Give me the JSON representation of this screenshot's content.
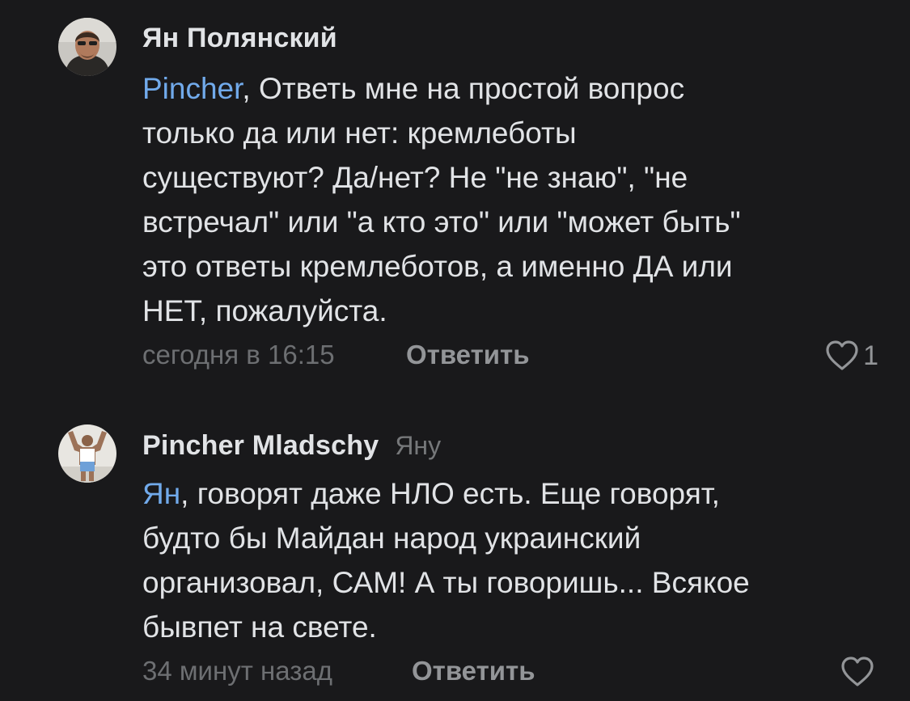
{
  "colors": {
    "background": "#19191b",
    "text": "#e1e3e6",
    "mention": "#71aaeb",
    "muted": "#6d6f72",
    "action": "#939598"
  },
  "comments": [
    {
      "author": "Ян Полянский",
      "reply_to": "",
      "mention": "Pincher",
      "text_lines": [
        ", Ответь мне на простой вопрос",
        "только да или нет: кремлеботы",
        "существуют? Да/нет?  Не \"не знаю\", \"не",
        "встречал\" или \"а кто это\" или \"может быть\"",
        "это ответы кремлеботов, а именно ДА или",
        "НЕТ, пожалуйста."
      ],
      "time": "сегодня в 16:15",
      "reply_label": "Ответить",
      "like_icon": "heart-outline-icon",
      "like_count": "1"
    },
    {
      "author": "Pincher Mladschy",
      "reply_to": "Яну",
      "mention": "Ян",
      "text_lines": [
        ", говорят даже НЛО есть. Еще говорят,",
        "будто бы Майдан народ украинский",
        "организовал, САМ! А ты говоришь... Всякое",
        "бывпет на свете."
      ],
      "time": "34 минут назад",
      "reply_label": "Ответить",
      "like_icon": "heart-outline-icon",
      "like_count": ""
    }
  ]
}
